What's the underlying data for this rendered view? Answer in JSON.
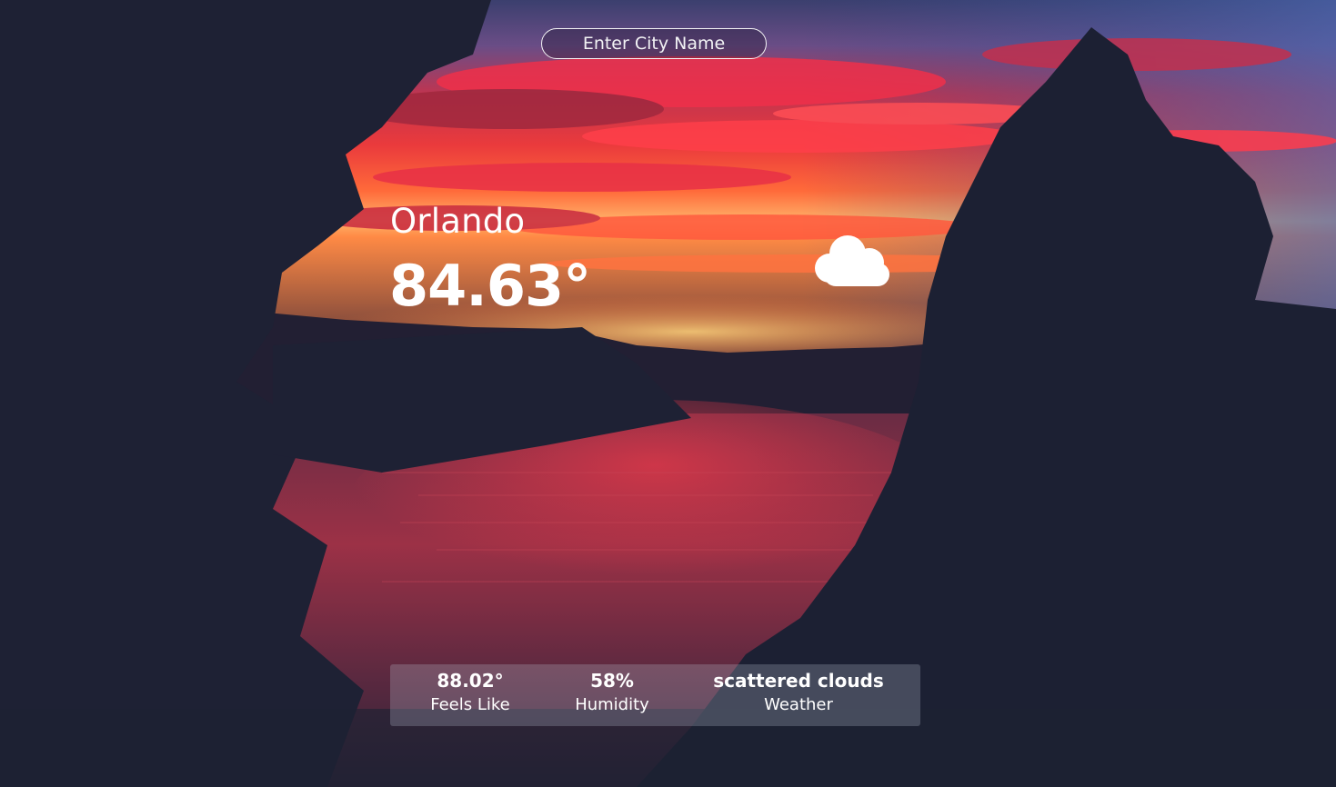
{
  "search": {
    "placeholder": "Enter City Name"
  },
  "current": {
    "city": "Orlando",
    "temperature": "84.63°",
    "condition_icon": "cloud-icon"
  },
  "stats": [
    {
      "value": "88.02°",
      "label": "Feels Like"
    },
    {
      "value": "58%",
      "label": "Humidity"
    },
    {
      "value": "scattered clouds",
      "label": "Weather"
    }
  ],
  "colors": {
    "text": "#ffffff",
    "stats_panel": "#bec4d4",
    "sky_red": "#e8283c",
    "sky_blue": "#5a6fa8",
    "silhouette": "#1d2233"
  }
}
